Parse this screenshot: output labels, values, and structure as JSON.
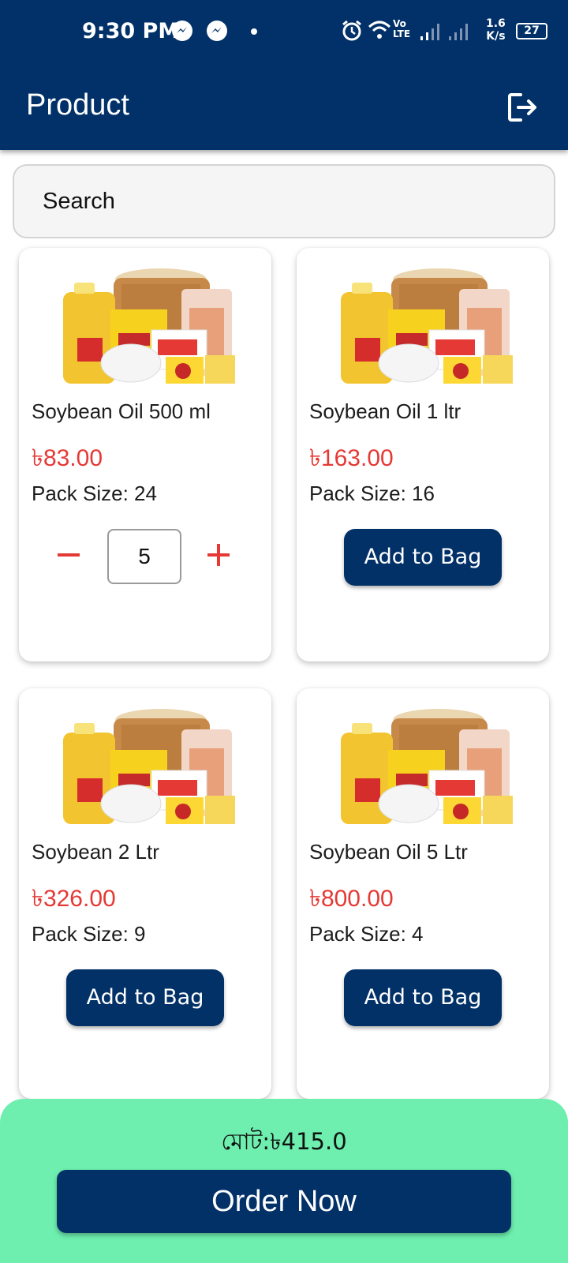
{
  "status_bar": {
    "time": "9:30 PM",
    "network_speed_value": "1.6",
    "network_speed_unit": "K/s",
    "battery": "27",
    "net_label_top": "Vo",
    "net_label_bottom": "LTE"
  },
  "appbar": {
    "title": "Product",
    "background": "#013168"
  },
  "search": {
    "placeholder": "Search"
  },
  "products": [
    {
      "name": "Soybean Oil 500 ml",
      "price": "৳83.00",
      "pack_size": "Pack Size: 24",
      "quantity": "5",
      "in_bag": true
    },
    {
      "name": "Soybean Oil 1 ltr",
      "price": "৳163.00",
      "pack_size": "Pack Size: 16",
      "button": "Add to Bag",
      "in_bag": false
    },
    {
      "name": "Soybean 2 Ltr",
      "price": "৳326.00",
      "pack_size": "Pack Size: 9",
      "button": "Add to Bag",
      "in_bag": false
    },
    {
      "name": "Soybean Oil 5 Ltr",
      "price": "৳800.00",
      "pack_size": "Pack Size: 4",
      "button": "Add to Bag",
      "in_bag": false
    }
  ],
  "footer": {
    "total": "মোট:৳415.0",
    "order_button": "Order Now",
    "background": "#6eefaf"
  },
  "colors": {
    "primary": "#023168",
    "price": "#e53935"
  },
  "icons": {
    "logout": "logout-icon",
    "minus": "minus-icon",
    "plus": "plus-icon"
  }
}
